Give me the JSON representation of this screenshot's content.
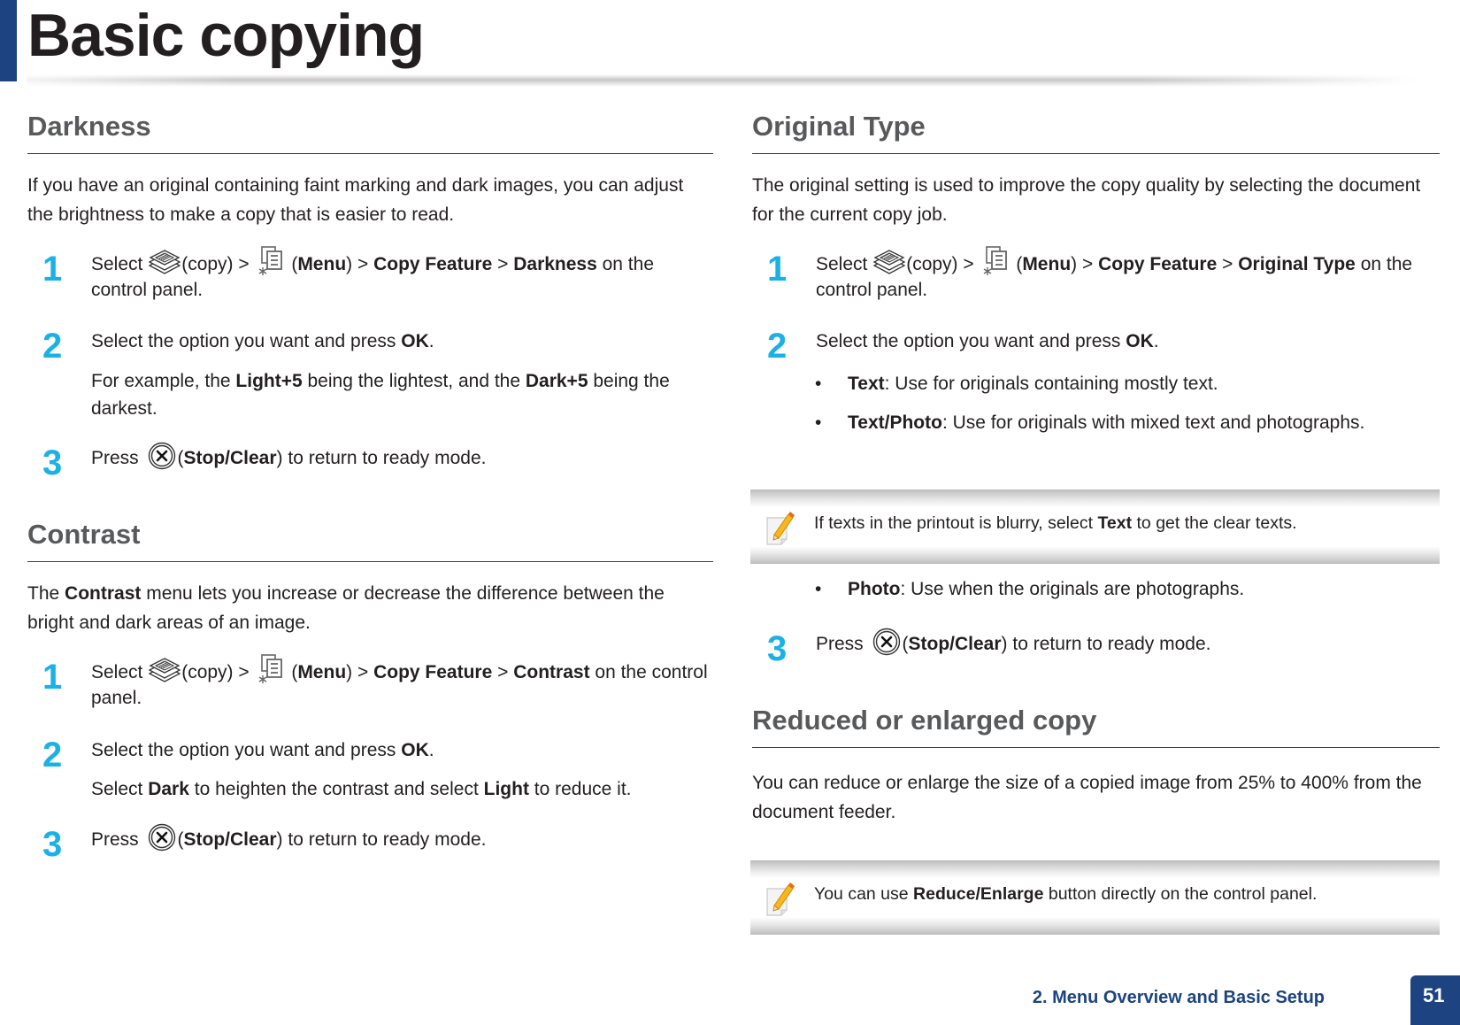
{
  "header": {
    "title": "Basic copying"
  },
  "left": {
    "darkness": {
      "heading": "Darkness",
      "intro": "If you have an original containing faint marking and dark images, you can adjust the brightness to make a copy that is easier to read.",
      "steps": [
        {
          "num": "1",
          "select": "Select ",
          "copy": "(copy) > ",
          "menu_open": " (",
          "menu": "Menu",
          "menu_close": ") > ",
          "feature": "Copy Feature",
          "sep": " > ",
          "target": "Darkness",
          "tail": " on the control panel."
        },
        {
          "num": "2",
          "text": "Select the option you want and press ",
          "ok": "OK",
          "dot": ".",
          "sub_pre": "For example, the ",
          "sub_b1": "Light+5",
          "sub_mid": " being the lightest, and the ",
          "sub_b2": "Dark+5",
          "sub_post": " being the darkest."
        },
        {
          "num": "3",
          "press": "Press ",
          "paren_open": "(",
          "stop": "Stop/Clear",
          "tail": ") to return to ready mode."
        }
      ]
    },
    "contrast": {
      "heading": "Contrast",
      "intro_pre": "The ",
      "intro_b": "Contrast",
      "intro_post": " menu lets you increase or decrease the difference between the bright and dark areas of an image.",
      "steps": [
        {
          "num": "1",
          "select": "Select ",
          "copy": "(copy) > ",
          "menu_open": " (",
          "menu": "Menu",
          "menu_close": ") > ",
          "feature": "Copy Feature",
          "sep": " > ",
          "target": "Contrast",
          "tail": " on the control panel."
        },
        {
          "num": "2",
          "text": "Select the option you want and press ",
          "ok": "OK",
          "dot": ".",
          "sub_pre": "Select ",
          "sub_b1": "Dark",
          "sub_mid": " to heighten the contrast and select ",
          "sub_b2": "Light",
          "sub_post": " to reduce it."
        },
        {
          "num": "3",
          "press": "Press ",
          "paren_open": "(",
          "stop": "Stop/Clear",
          "tail": ") to return to ready mode."
        }
      ]
    }
  },
  "right": {
    "original_type": {
      "heading": "Original Type",
      "intro": "The original setting is used to improve the copy quality by selecting the document for the current copy job.",
      "step1": {
        "num": "1",
        "select": "Select ",
        "copy": "(copy) > ",
        "menu_open": " (",
        "menu": "Menu",
        "menu_close": ") > ",
        "feature": "Copy Feature",
        "sep": " > ",
        "target": "Original Type",
        "tail": " on the control panel."
      },
      "step2": {
        "num": "2",
        "text": "Select the option you want and press ",
        "ok": "OK",
        "dot": "."
      },
      "bullets": [
        {
          "label": "Text",
          "desc": ": Use for originals containing mostly text."
        },
        {
          "label": "Text/Photo",
          "desc": ": Use for originals with mixed text and photographs."
        },
        {
          "label": "Photo",
          "desc": ": Use when the originals are photographs."
        }
      ],
      "note": {
        "pre": "If texts in the printout is blurry, select ",
        "bold": "Text",
        "post": " to get the clear texts."
      },
      "step3": {
        "num": "3",
        "press": "Press ",
        "paren_open": "(",
        "stop": "Stop/Clear",
        "tail": ") to return to ready mode."
      }
    },
    "reduce": {
      "heading": "Reduced or enlarged copy",
      "intro": "You can reduce or enlarge the size of a copied image from 25% to 400% from the document feeder.",
      "note": {
        "pre": "You can use ",
        "bold": "Reduce/Enlarge",
        "post": " button directly on the control panel."
      }
    }
  },
  "footer": {
    "chapter": "2.  Menu Overview and Basic Setup",
    "page": "51"
  },
  "icons": {
    "copy": "copy-icon",
    "menu": "menu-icon",
    "stop": "stop-clear-icon",
    "note": "note-pencil-icon"
  }
}
